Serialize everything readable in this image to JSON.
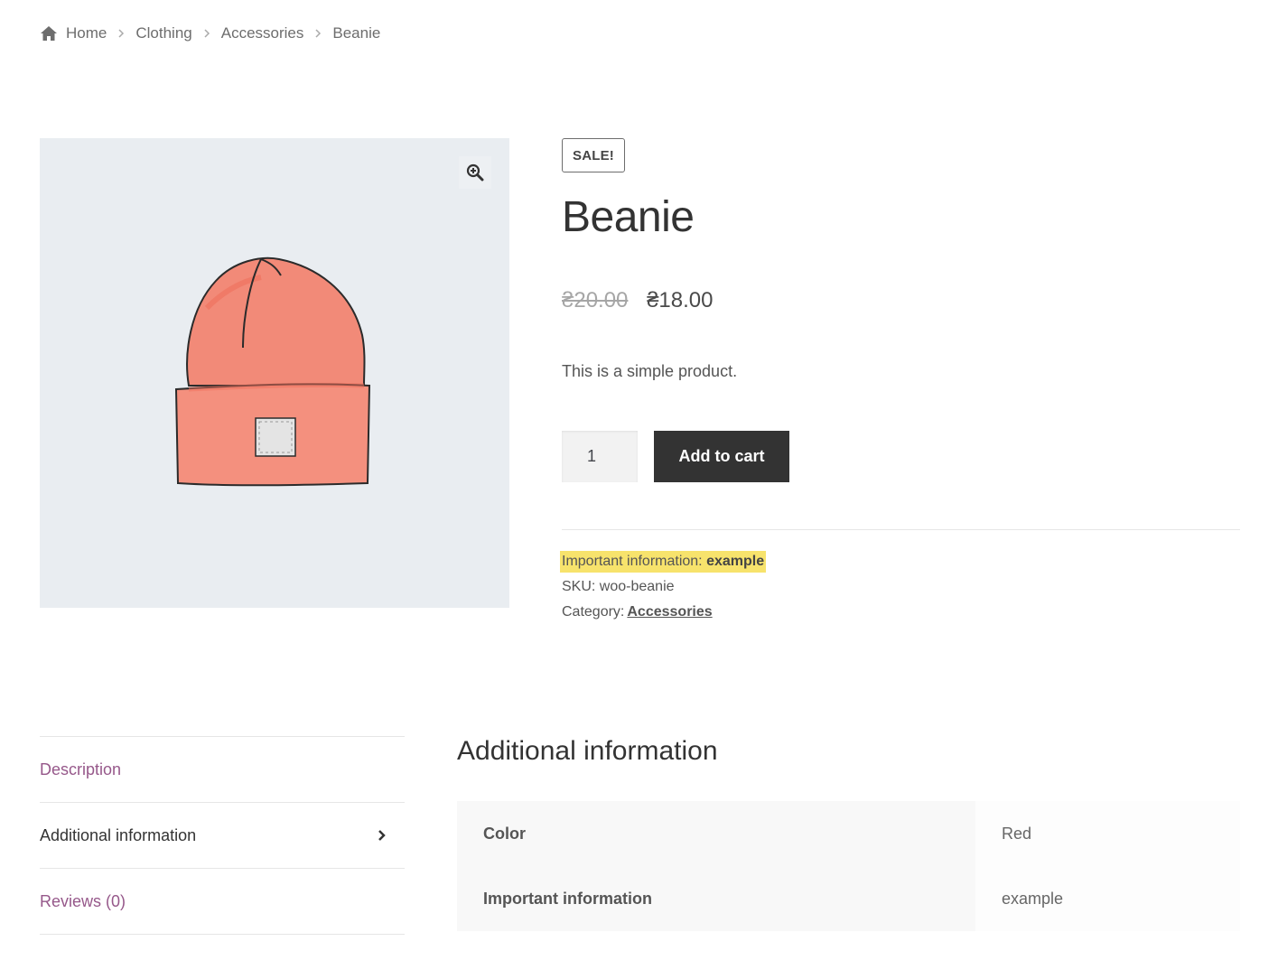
{
  "breadcrumb": {
    "items": [
      "Home",
      "Clothing",
      "Accessories",
      "Beanie"
    ]
  },
  "product": {
    "sale_badge": "SALE!",
    "title": "Beanie",
    "price_old": "₴20.00",
    "price_new": "₴18.00",
    "short_description": "This is a simple product.",
    "quantity": "1",
    "add_to_cart_label": "Add to cart",
    "meta": {
      "important_label": "Important information:",
      "important_value": "example",
      "sku_label": "SKU:",
      "sku_value": "woo-beanie",
      "category_label": "Category:",
      "category_value": "Accessories"
    },
    "image_colors": {
      "hat": "#f28a78",
      "patch": "#e4e4e4",
      "background": "#e9edf1"
    }
  },
  "tabs": {
    "items": [
      "Description",
      "Additional information",
      "Reviews (0)"
    ],
    "active_index": 1
  },
  "panel": {
    "title": "Additional information",
    "rows": [
      {
        "label": "Color",
        "value": "Red"
      },
      {
        "label": "Important information",
        "value": "example"
      }
    ]
  },
  "colors": {
    "link": "#96588a",
    "button": "#333333",
    "highlight": "#f7e36c"
  }
}
